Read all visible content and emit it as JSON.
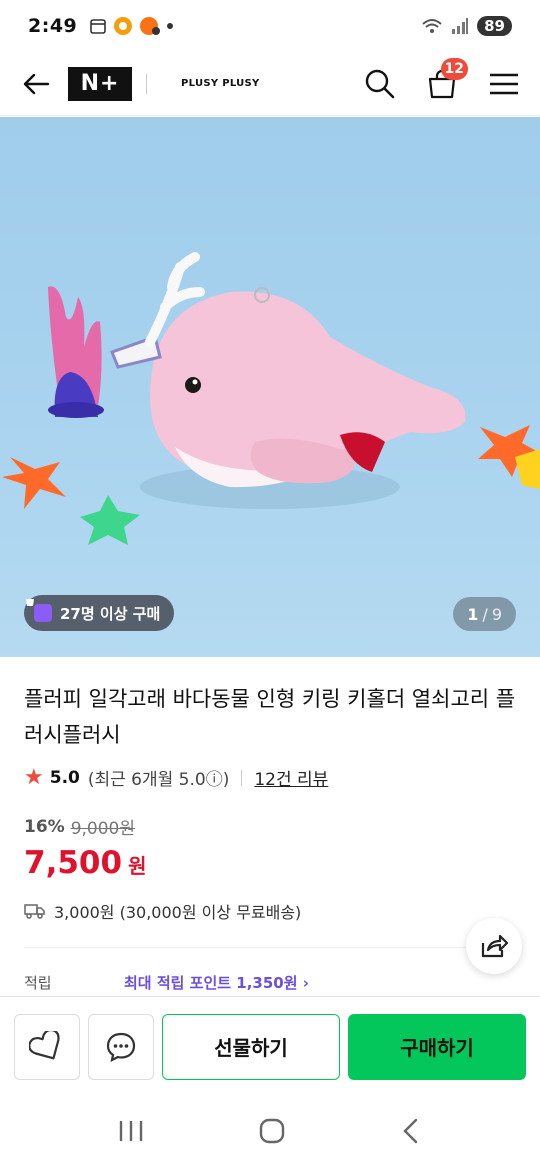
{
  "status_bar": {
    "time": "2:49",
    "battery": "89"
  },
  "nav": {
    "logo": "N+",
    "store_name": "PLUSY PLUSY",
    "cart_count": "12"
  },
  "hero": {
    "buyers_label": "27명 이상 구매",
    "current_image": "1",
    "total_images": "9"
  },
  "product": {
    "title": "플러피 일각고래 바다동물 인형 키링 키홀더 열쇠고리 플러시플러시",
    "rating": "5.0",
    "rating_recent": "(최근 6개월 5.0ⓘ)",
    "review_count": "12건 리뷰",
    "discount_rate": "16%",
    "original_price": "9,000원",
    "price": "7,500",
    "price_unit": "원",
    "shipping": "3,000원 (30,000원 이상 무료배송)",
    "points_label": "적립",
    "points_value": "최대 적립 포인트 1,350원 ›"
  },
  "actions": {
    "gift_label": "선물하기",
    "buy_label": "구매하기"
  },
  "colors": {
    "accent_green": "#03c75a",
    "price_red": "#e0112d",
    "badge_red": "#f04a3a",
    "points_purple": "#6b4fe0"
  }
}
